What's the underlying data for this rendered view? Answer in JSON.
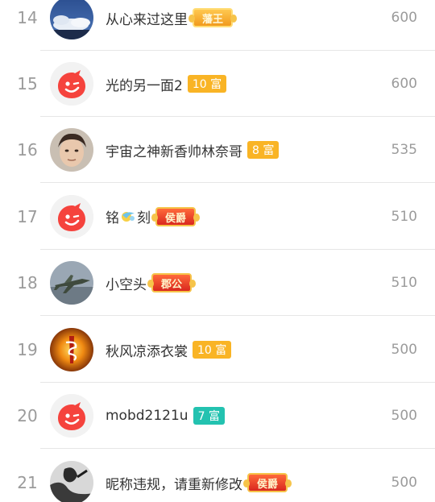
{
  "rows": [
    {
      "rank": "14",
      "name": "从心来过这里",
      "badge": {
        "type": "title",
        "style": "gold",
        "text": "藩王"
      },
      "score": "600",
      "avatar": "sky-cloud-avatar"
    },
    {
      "rank": "15",
      "name": "光的另一面2",
      "badge": {
        "type": "fu",
        "style": "orange",
        "text": "10 富"
      },
      "score": "600",
      "avatar": "default-red-avatar"
    },
    {
      "rank": "16",
      "name": "宇宙之神新香帅林奈哥",
      "badge": {
        "type": "fu",
        "style": "orange",
        "text": "8 富"
      },
      "score": "535",
      "avatar": "face-photo-avatar"
    },
    {
      "rank": "17",
      "name_before": "铭",
      "name_after": "刻",
      "badge": {
        "type": "title",
        "style": "red",
        "text": "侯爵"
      },
      "score": "510",
      "avatar": "default-red-avatar"
    },
    {
      "rank": "18",
      "name": "小空头",
      "badge": {
        "type": "title",
        "style": "red",
        "text": "郡公"
      },
      "score": "510",
      "avatar": "jet-avatar"
    },
    {
      "rank": "19",
      "name": "秋风凉添衣裳",
      "badge": {
        "type": "fu",
        "style": "orange",
        "text": "10 富"
      },
      "score": "500",
      "avatar": "fire-avatar"
    },
    {
      "rank": "20",
      "name": "mobd2121u",
      "badge": {
        "type": "fu",
        "style": "teal",
        "text": "7 富"
      },
      "score": "500",
      "avatar": "default-red-avatar"
    },
    {
      "rank": "21",
      "name": "昵称违规，请重新修改",
      "badge": {
        "type": "title",
        "style": "red",
        "text": "侯爵"
      },
      "score": "500",
      "avatar": "bw-photo-avatar"
    }
  ],
  "colors": {
    "fu_orange": "#f9b425",
    "fu_teal": "#23c2b0",
    "title_red": "#d9281f",
    "default_avatar": "#f5433d"
  }
}
